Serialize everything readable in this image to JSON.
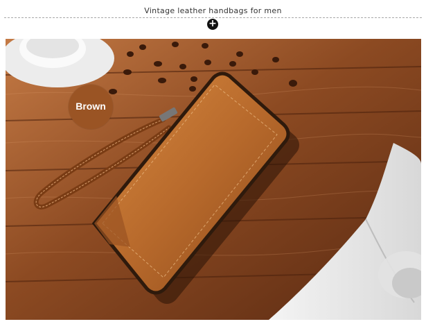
{
  "header": {
    "title": "Vintage leather handbags for men",
    "expand_icon": "plus-circle-icon"
  },
  "product_image": {
    "color_label": "Brown",
    "badge_color": "#9a5424",
    "wallet_color": "#b86a2c",
    "wood_color": "#8a4a22"
  }
}
